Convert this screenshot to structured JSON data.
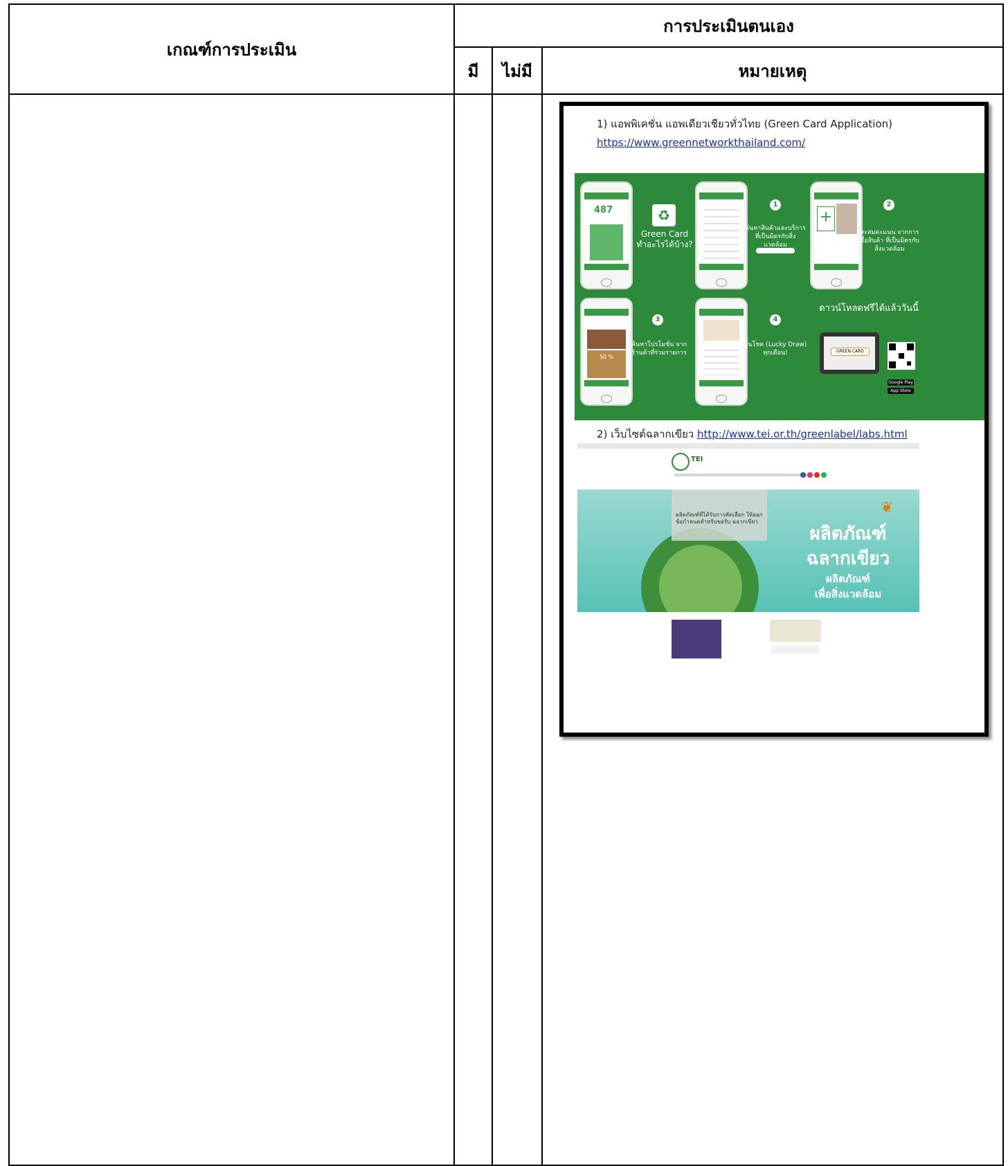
{
  "table": {
    "header_criteria": "เกณฑ์การประเมิน",
    "header_self_assessment": "การประเมินตนเอง",
    "header_yes": "มี",
    "header_no": "ไม่มี",
    "header_remark": "หมายเหตุ"
  },
  "remark": {
    "item1_text": "1) แอพพิเคชั่น แอพเดียวเชียวทั่วไทย (Green Card Application)",
    "item1_link": "https://www.greennetworkthailand.com/",
    "item2_prefix": "2)  เว็บไซต์ฉลากเขียว ",
    "item2_link": "http://www.tei.or.th/greenlabel/labs.html"
  },
  "green_card_graphic": {
    "points": "487",
    "title_line1": "Green Card",
    "title_line2": "ทำอะไรได้บ้าง?",
    "step1_num": "1",
    "step1_text": "ค้นหาสินค้าและบริการ ที่เป็นมิตรกับสิ่งแวดล้อม",
    "step2_num": "2",
    "step2_text": "สะสมคะแนน จากการซื้อสินค้า ที่เป็นมิตรกับสิ่งแวดล้อม",
    "step3_num": "3",
    "step3_text": "ค้นหาโปรโมชั่น จากร้านค้าที่ร่วมรายการ",
    "step4_num": "4",
    "step4_text": "ลุ้นโชค (Lucky Draw) ทุกเดือน!",
    "download_text": "ดาวน์โหลดฟรีได้แล้ววันนี้",
    "tablet_button": "GREEN CARD",
    "google_play": "Google Play",
    "app_store": "App Store",
    "promo_percent": "50 %"
  },
  "tei_site": {
    "logo_text": "TEI",
    "banner_box_text": "ผลิตภัณฑ์ที่ได้รับการคัดเลือก ให้ออกข้อกำหนดสำหรับขอรับ ฉลากเขียว",
    "banner_title_1": "ผลิตภัณฑ์",
    "banner_title_2": "ฉลากเขียว",
    "banner_sub_1": "ผลิตภัณฑ์",
    "banner_sub_2": "เพื่อสิ่งแวดล้อม"
  }
}
